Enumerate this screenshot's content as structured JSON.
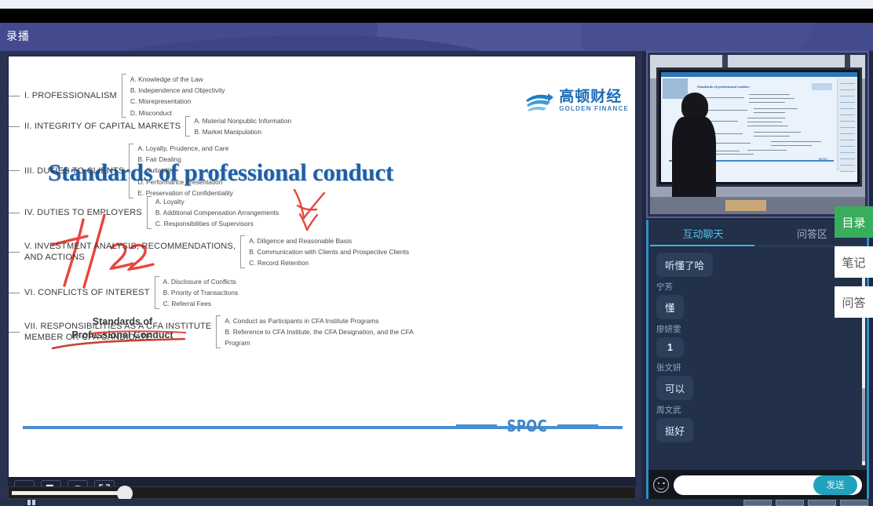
{
  "app": {
    "title": "录播"
  },
  "slide": {
    "title": "Standards of professional conduct",
    "logo": {
      "cn": "高顿财经",
      "en": "GOLDEN FINANCE",
      "icon": "golden-finance-swoosh-icon"
    },
    "annotations": {
      "date": "7/22",
      "note_line1": "Standards of",
      "note_line2": "Professional Conduct"
    },
    "footer_brand": "SPOC",
    "tree": [
      {
        "label": "I. PROFESSIONALISM",
        "children": [
          "A. Knowledge of the Law",
          "B. Independence and Objectivity",
          "C. Misrepresentation",
          "D. Misconduct"
        ]
      },
      {
        "label": "II. INTEGRITY OF CAPITAL MARKETS",
        "children": [
          "A. Material Nonpublic Information",
          "B. Market Manipulation"
        ]
      },
      {
        "label": "III. DUTIES TO CLIENTS",
        "children": [
          "A. Loyalty, Prudence, and Care",
          "B. Fair Dealing",
          "C. Suitability",
          "D. Performance Presentation",
          "E. Preservation of Confidentiality"
        ]
      },
      {
        "label": "IV. DUTIES TO EMPLOYERS",
        "children": [
          "A. Loyalty",
          "B. Additional Compensation Arrangements",
          "C. Responsibilities of Supervisors"
        ]
      },
      {
        "label": "V. INVESTMENT ANALYSIS, RECOMMENDATIONS,\n AND ACTIONS",
        "children": [
          "A. Diligence and Reasonable Basis",
          "B. Communication with Clients and Prospective Clients",
          "C. Record Retention"
        ]
      },
      {
        "label": "VI. CONFLICTS OF INTEREST",
        "children": [
          "A. Disclosure of Conflicts",
          "B. Priority of Transactions",
          "C. Referral Fees"
        ]
      },
      {
        "label": "VII. RESPONSIBILITIES AS A CFA INSTITUTE\nMEMBER OR CFA CANDIDATE",
        "children": [
          "A. Conduct as Participants in CFA Institute Programs",
          "B. Reference to CFA Institute, the CFA Designation, and the CFA",
          "Program"
        ]
      }
    ]
  },
  "player": {
    "controls": [
      {
        "name": "playlist-icon",
        "label": "playlist"
      },
      {
        "name": "picture-in-picture-icon",
        "label": "pip"
      },
      {
        "name": "signal-icon",
        "label": "signal"
      },
      {
        "name": "fullscreen-icon",
        "label": "fullscreen"
      }
    ]
  },
  "video": {
    "mini_slide_title": "Standards of professional conduct",
    "mini_spoc": "SPOC"
  },
  "chat": {
    "tabs": [
      {
        "label": "互动聊天",
        "active": true
      },
      {
        "label": "问答区",
        "active": false
      }
    ],
    "messages": [
      {
        "name": "",
        "text": "听懂了哈"
      },
      {
        "name": "宁芳",
        "text": "懂"
      },
      {
        "name": "廖妍雯",
        "text": "1"
      },
      {
        "name": "张文妍",
        "text": "可以"
      },
      {
        "name": "周文武",
        "text": "挺好"
      }
    ],
    "input": {
      "value": "",
      "placeholder": ""
    },
    "send_label": "发送",
    "emoji_icon": "emoji-smiley-icon"
  },
  "side_tools": [
    {
      "label": "目录",
      "style": "green"
    },
    {
      "label": "笔记",
      "style": "white"
    },
    {
      "label": "问答",
      "style": "white"
    }
  ],
  "colors": {
    "header_purple": "#434a8d",
    "slide_title_blue": "#1f5fa8",
    "accent_cyan": "#35b7dd",
    "green": "#3aad5d",
    "annotation_red": "#e8453c"
  }
}
